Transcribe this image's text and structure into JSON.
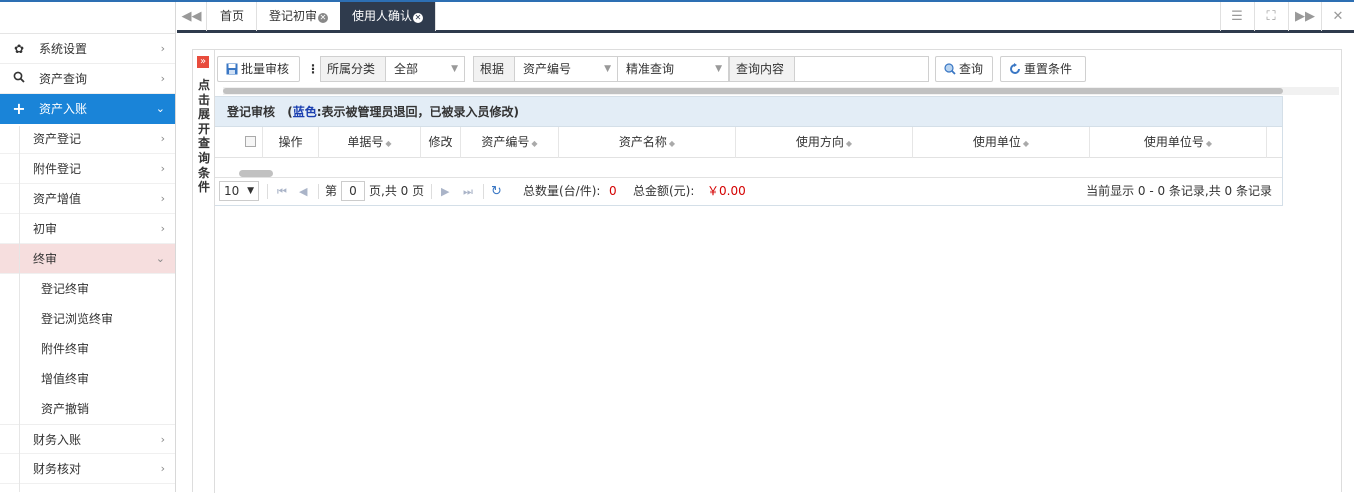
{
  "sidebar": {
    "items": [
      {
        "label": "系统设置",
        "icon": "gear-icon"
      },
      {
        "label": "资产查询",
        "icon": "search-icon"
      },
      {
        "label": "资产入账",
        "icon": "plus-icon"
      }
    ],
    "sub_items": [
      {
        "label": "资产登记"
      },
      {
        "label": "附件登记"
      },
      {
        "label": "资产增值"
      },
      {
        "label": "初审"
      },
      {
        "label": "终审"
      }
    ],
    "final_review_items": [
      {
        "label": "登记终审"
      },
      {
        "label": "登记浏览终审"
      },
      {
        "label": "附件终审"
      },
      {
        "label": "增值终审"
      },
      {
        "label": "资产撤销"
      }
    ],
    "after_items": [
      {
        "label": "财务入账"
      },
      {
        "label": "财务核对"
      }
    ]
  },
  "tabs": [
    {
      "label": "首页"
    },
    {
      "label": "登记初审"
    },
    {
      "label": "使用人确认"
    }
  ],
  "side_toggle": {
    "text": "点击展开查询条件"
  },
  "toolbar": {
    "batch_review_label": "批量审核",
    "category_label": "所属分类",
    "category_value": "全部",
    "basis_label": "根据",
    "field_value": "资产编号",
    "match_value": "精准查询",
    "query_content_label": "查询内容",
    "query_content_value": "",
    "search_label": "查询",
    "reset_label": "重置条件"
  },
  "grid": {
    "title": "登记审核",
    "note_open": "(",
    "note_color": "蓝色",
    "note_rest": ":表示被管理员退回，已被录入员修改)",
    "columns": [
      "操作",
      "单据号",
      "修改",
      "资产编号",
      "资产名称",
      "使用方向",
      "使用单位",
      "使用单位号"
    ]
  },
  "pager": {
    "page_size": "10",
    "page_prefix": "第",
    "page_number": "0",
    "page_suffix": "页,共 0 页",
    "total_count_label": "总数量(台/件):",
    "total_count_value": "0",
    "total_amount_label": "总金额(元):",
    "total_amount_value": "￥0.00",
    "record_info": "当前显示 0 - 0 条记录,共 0 条记录"
  },
  "colors": {
    "accent": "#1a84d8",
    "tab_active": "#2f3b4d",
    "highlight_row": "#f6dede",
    "grid_header": "#e3edf6",
    "money_red": "#d40000"
  }
}
